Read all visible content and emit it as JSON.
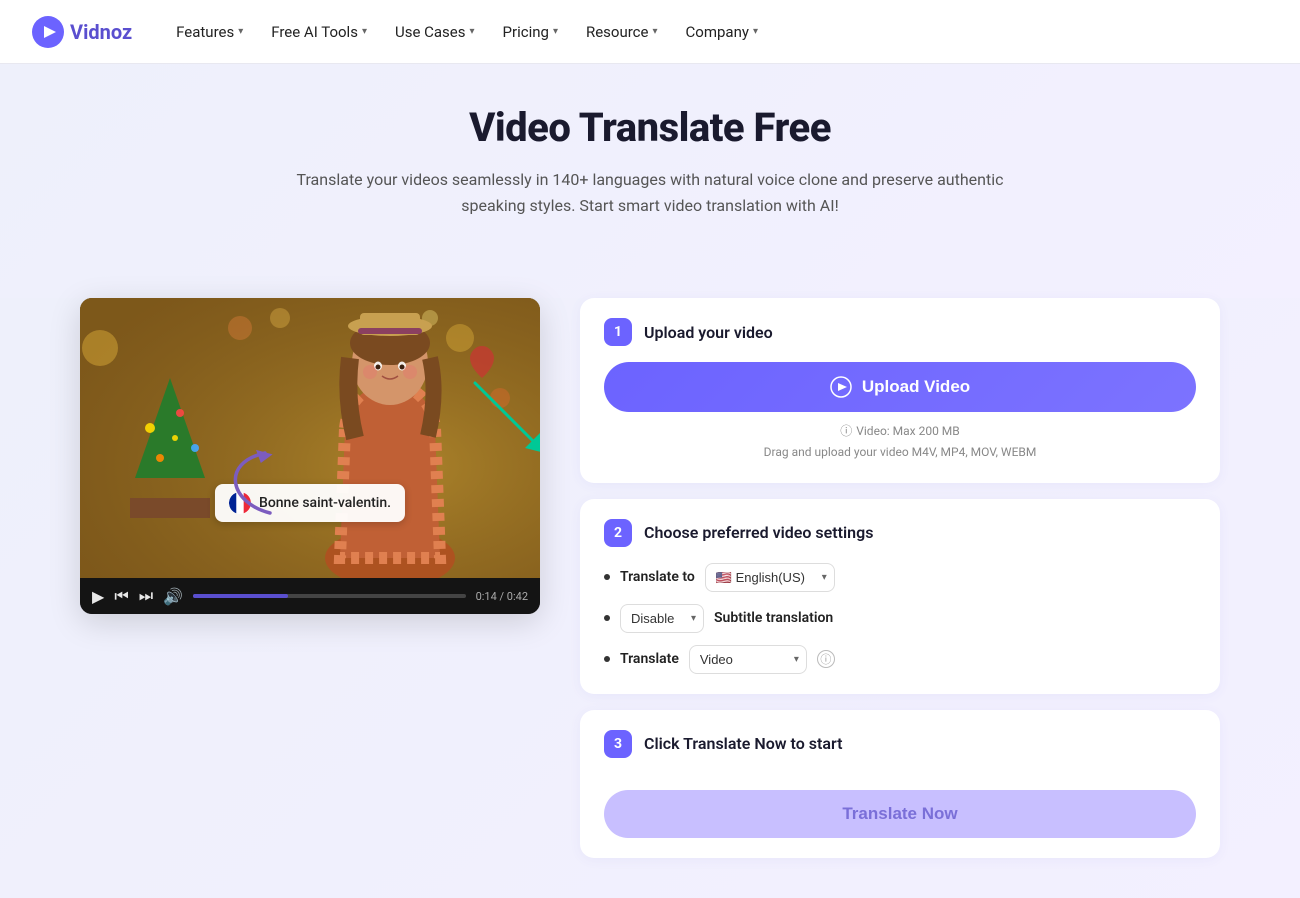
{
  "brand": {
    "name": "Vidnoz",
    "logo_text": "Vidnoz"
  },
  "nav": {
    "items": [
      {
        "label": "Features",
        "has_dropdown": true
      },
      {
        "label": "Free AI Tools",
        "has_dropdown": true
      },
      {
        "label": "Use Cases",
        "has_dropdown": true
      },
      {
        "label": "Pricing",
        "has_dropdown": true
      },
      {
        "label": "Resource",
        "has_dropdown": true
      },
      {
        "label": "Company",
        "has_dropdown": true
      }
    ]
  },
  "hero": {
    "title": "Video Translate Free",
    "subtitle": "Translate your videos seamlessly in 140+ languages with natural voice clone and preserve authentic speaking styles. Start smart video translation with AI!"
  },
  "step1": {
    "badge": "1",
    "title": "Upload your video",
    "upload_btn_label": "Upload Video",
    "video_size_label": "Video: Max 200 MB",
    "drag_label": "Drag and upload your video M4V, MP4, MOV, WEBM"
  },
  "step2": {
    "badge": "2",
    "title": "Choose preferred video settings",
    "translate_to_label": "Translate to",
    "language_value": "English(US)",
    "subtitle_label": "Subtitle translation",
    "subtitle_option": "Disable",
    "translate_label": "Translate",
    "translate_option": "Video"
  },
  "step3": {
    "badge": "3",
    "title": "Click Translate Now to start",
    "btn_label": "Translate Now"
  },
  "video": {
    "subtitle_text": "Bonne saint-valentin.",
    "time": "0:14 / 0:42"
  }
}
